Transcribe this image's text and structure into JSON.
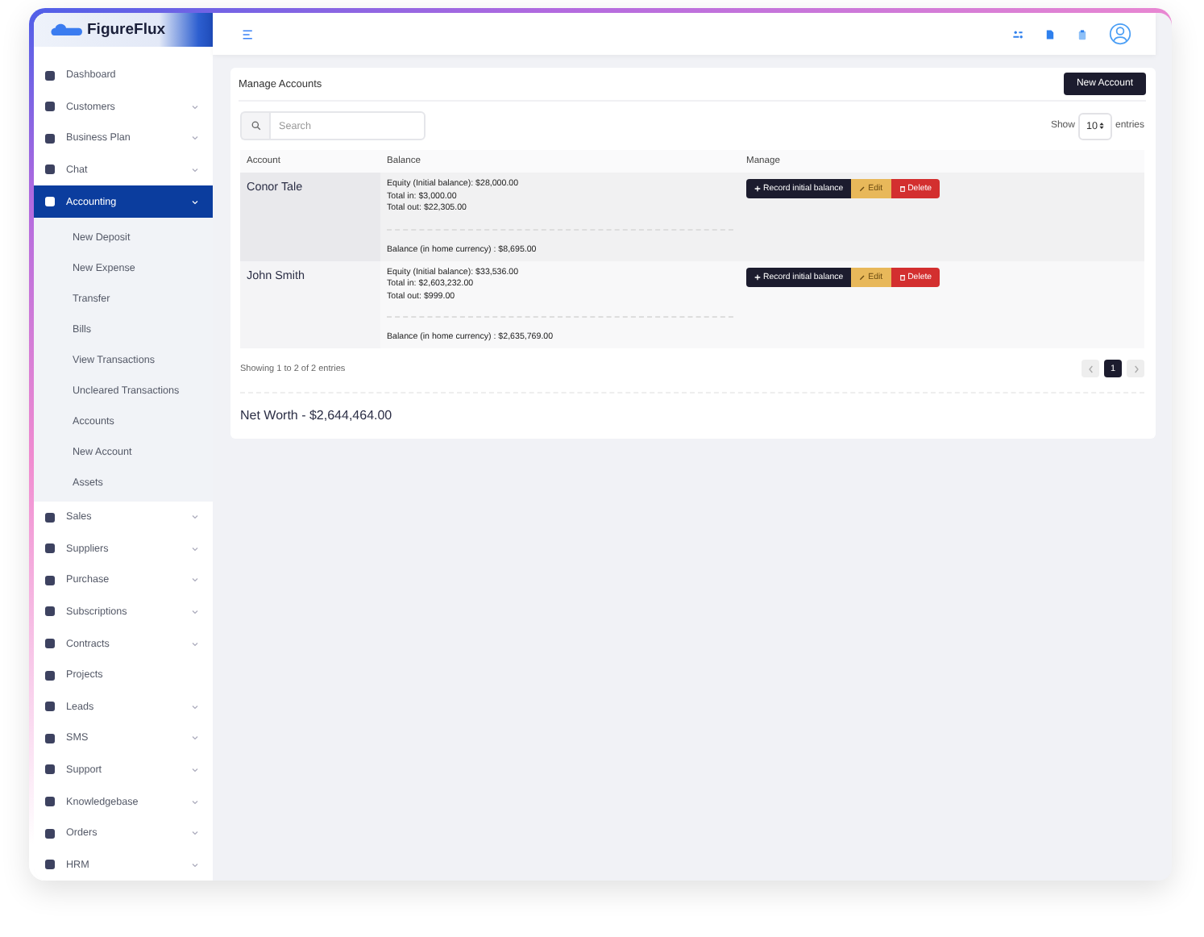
{
  "brand": {
    "name": "FigureFlux"
  },
  "sidebar": {
    "items": [
      {
        "label": "Dashboard",
        "expandable": false,
        "expanded": false
      },
      {
        "label": "Customers",
        "expandable": true,
        "expanded": false
      },
      {
        "label": "Business Plan",
        "expandable": true,
        "expanded": false
      },
      {
        "label": "Chat",
        "expandable": true,
        "expanded": false
      },
      {
        "label": "Accounting",
        "expandable": true,
        "expanded": true,
        "children": [
          {
            "label": "New Deposit"
          },
          {
            "label": "New Expense"
          },
          {
            "label": "Transfer"
          },
          {
            "label": "Bills"
          },
          {
            "label": "View Transactions"
          },
          {
            "label": "Uncleared Transactions"
          },
          {
            "label": "Accounts"
          },
          {
            "label": "New Account"
          },
          {
            "label": "Assets"
          }
        ]
      },
      {
        "label": "Sales",
        "expandable": true,
        "expanded": false
      },
      {
        "label": "Suppliers",
        "expandable": true,
        "expanded": false
      },
      {
        "label": "Purchase",
        "expandable": true,
        "expanded": false
      },
      {
        "label": "Subscriptions",
        "expandable": true,
        "expanded": false
      },
      {
        "label": "Contracts",
        "expandable": true,
        "expanded": false
      },
      {
        "label": "Projects",
        "expandable": false,
        "expanded": false
      },
      {
        "label": "Leads",
        "expandable": true,
        "expanded": false
      },
      {
        "label": "SMS",
        "expandable": true,
        "expanded": false
      },
      {
        "label": "Support",
        "expandable": true,
        "expanded": false
      },
      {
        "label": "Knowledgebase",
        "expandable": true,
        "expanded": false
      },
      {
        "label": "Orders",
        "expandable": true,
        "expanded": false
      },
      {
        "label": "HRM",
        "expandable": true,
        "expanded": false
      }
    ]
  },
  "card": {
    "title": "Manage Accounts",
    "new_button": "New Account",
    "search": {
      "placeholder": "Search"
    },
    "page_size": {
      "prefix": "Show",
      "value": "10",
      "suffix": "entries"
    },
    "table": {
      "columns": [
        "Account",
        "Balance",
        "Manage"
      ],
      "rows": [
        {
          "account": "Conor Tale",
          "lines": [
            "Equity (Initial balance): $28,000.00",
            "Total in: $3,000.00",
            "Total out: $22,305.00"
          ],
          "home_balance": "Balance (in home currency) : $8,695.00",
          "actions": [
            "Record initial balance",
            "Edit",
            "Delete"
          ]
        },
        {
          "account": "John Smith",
          "lines": [
            "Equity (Initial balance): $33,536.00",
            "Total in: $2,603,232.00",
            "Total out: $999.00"
          ],
          "home_balance": "Balance (in home currency) : $2,635,769.00",
          "actions": [
            "Record initial balance",
            "Edit",
            "Delete"
          ]
        }
      ]
    },
    "info": "Showing 1 to 2 of 2 entries",
    "pages": [
      {
        "label": "1",
        "selected": true
      }
    ],
    "net_worth": "Net Worth - $2,644,464.00"
  }
}
